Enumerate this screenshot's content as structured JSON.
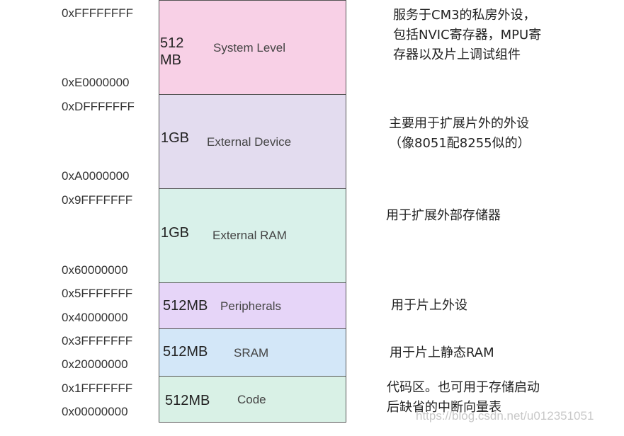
{
  "regions": [
    {
      "size": "512\nMB",
      "name": "System Level",
      "color": "#f8d0e6",
      "start": "0xE0000000",
      "end": "0xFFFFFFFF",
      "desc": "服务于CM3的私房外设，\n包括NVIC寄存器，MPU寄\n存器以及片上调试组件"
    },
    {
      "size": "1GB",
      "name": "External Device",
      "color": "#e3dcef",
      "start": "0xA0000000",
      "end": "0xDFFFFFFF",
      "desc": "主要用于扩展片外的外设\n（像8051配8255似的）"
    },
    {
      "size": "1GB",
      "name": "External RAM",
      "color": "#d9f1ea",
      "start": "0x60000000",
      "end": "0x9FFFFFFF",
      "desc": "用于扩展外部存储器"
    },
    {
      "size": "512MB",
      "name": "Peripherals",
      "color": "#e6d5f8",
      "start": "0x40000000",
      "end": "0x5FFFFFFF",
      "desc": "用于片上外设"
    },
    {
      "size": "512MB",
      "name": "SRAM",
      "color": "#d3e7f8",
      "start": "0x20000000",
      "end": "0x3FFFFFFF",
      "desc": "用于片上静态RAM"
    },
    {
      "size": "512MB",
      "name": "Code",
      "color": "#d9f1e6",
      "start": "0x00000000",
      "end": "0x1FFFFFFF",
      "desc": "代码区。也可用于存储启动\n后缺省的中断向量表"
    }
  ],
  "watermark": "https://blog.csdn.net/u012351051"
}
